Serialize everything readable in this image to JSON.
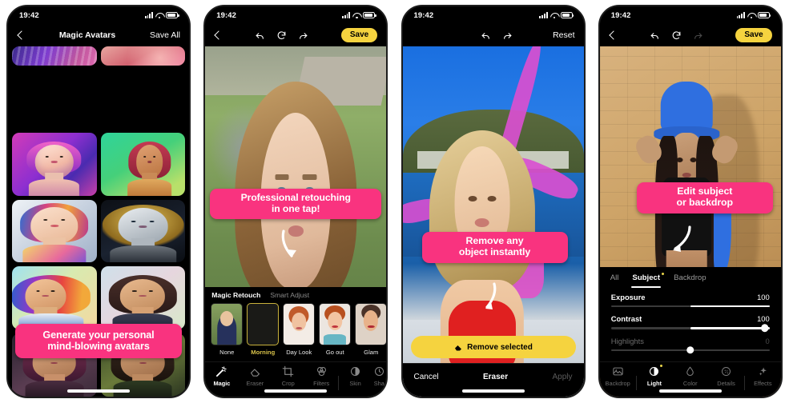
{
  "status_bar": {
    "time": "19:42",
    "signal_icon": "cellular-signal-icon",
    "wifi_icon": "wifi-icon",
    "battery_icon": "battery-icon"
  },
  "panels": [
    {
      "id": "magic-avatars",
      "nav": {
        "back_icon": "chevron-left-icon",
        "title": "Magic Avatars",
        "action_label": "Save All"
      },
      "callout": {
        "line1": "Generate your personal",
        "line2": "mind-blowing avatars",
        "color": "#F9337F"
      }
    },
    {
      "id": "magic-retouch",
      "nav": {
        "back_icon": "chevron-left-icon",
        "undo_icon": "undo-icon",
        "reset_icon": "reset-icon",
        "redo_icon": "redo-icon",
        "save_label": "Save"
      },
      "callout": {
        "line1": "Professional retouching",
        "line2": "in one tap!",
        "color": "#F9337F"
      },
      "tabs": [
        {
          "label": "Magic Retouch",
          "active": true
        },
        {
          "label": "Smart Adjust",
          "active": false
        }
      ],
      "presets": [
        {
          "label": "None",
          "selected": false
        },
        {
          "label": "Morning",
          "selected": true
        },
        {
          "label": "Day Look",
          "selected": false
        },
        {
          "label": "Go out",
          "selected": false
        },
        {
          "label": "Glam",
          "selected": false
        }
      ],
      "toolbar": [
        {
          "label": "Magic",
          "icon": "magic-wand-icon",
          "active": true
        },
        {
          "label": "Eraser",
          "icon": "eraser-icon",
          "active": false
        },
        {
          "label": "Crop",
          "icon": "crop-icon",
          "active": false
        },
        {
          "label": "Filters",
          "icon": "filters-icon",
          "active": false
        },
        {
          "label": "Skin",
          "icon": "skin-icon",
          "active": false
        },
        {
          "label": "Sha",
          "icon": "shape-icon",
          "active": false
        }
      ]
    },
    {
      "id": "object-eraser",
      "nav": {
        "undo_icon": "undo-icon",
        "redo_icon": "redo-icon",
        "action_label": "Reset"
      },
      "callout": {
        "line1": "Remove any",
        "line2": "object instantly",
        "color": "#F9337F"
      },
      "primary_button": {
        "label": "Remove selected",
        "icon": "eraser-icon",
        "color": "#F5D33F"
      },
      "actions": [
        {
          "label": "Cancel",
          "state": "enabled"
        },
        {
          "label": "Eraser",
          "state": "title"
        },
        {
          "label": "Apply",
          "state": "disabled"
        }
      ]
    },
    {
      "id": "subject-backdrop-adjust",
      "nav": {
        "back_icon": "chevron-left-icon",
        "undo_icon": "undo-icon",
        "reset_icon": "reset-icon",
        "redo_icon": "redo-icon",
        "save_label": "Save"
      },
      "callout": {
        "line1": "Edit subject",
        "line2": "or backdrop",
        "color": "#F9337F"
      },
      "segments": [
        {
          "label": "All",
          "active": false,
          "badge": false
        },
        {
          "label": "Subject",
          "active": true,
          "badge": true
        },
        {
          "label": "Backdrop",
          "active": false,
          "badge": false
        }
      ],
      "sliders": [
        {
          "label": "Exposure",
          "value": "100",
          "fill_start": 50,
          "fill_end": 100,
          "knob": null,
          "dim": false
        },
        {
          "label": "Contrast",
          "value": "100",
          "fill_start": 50,
          "fill_end": 100,
          "knob": 100,
          "dim": false
        },
        {
          "label": "Highlights",
          "value": "0",
          "fill_start": 50,
          "fill_end": 50,
          "knob": 50,
          "dim": true
        }
      ],
      "toolbar": [
        {
          "label": "Backdrop",
          "icon": "image-icon",
          "active": false
        },
        {
          "label": "Light",
          "icon": "contrast-icon",
          "active": true
        },
        {
          "label": "Color",
          "icon": "droplet-icon",
          "active": false
        },
        {
          "label": "Details",
          "icon": "details-icon",
          "active": false
        },
        {
          "label": "Effects",
          "icon": "sparkle-icon",
          "active": false
        }
      ]
    }
  ]
}
